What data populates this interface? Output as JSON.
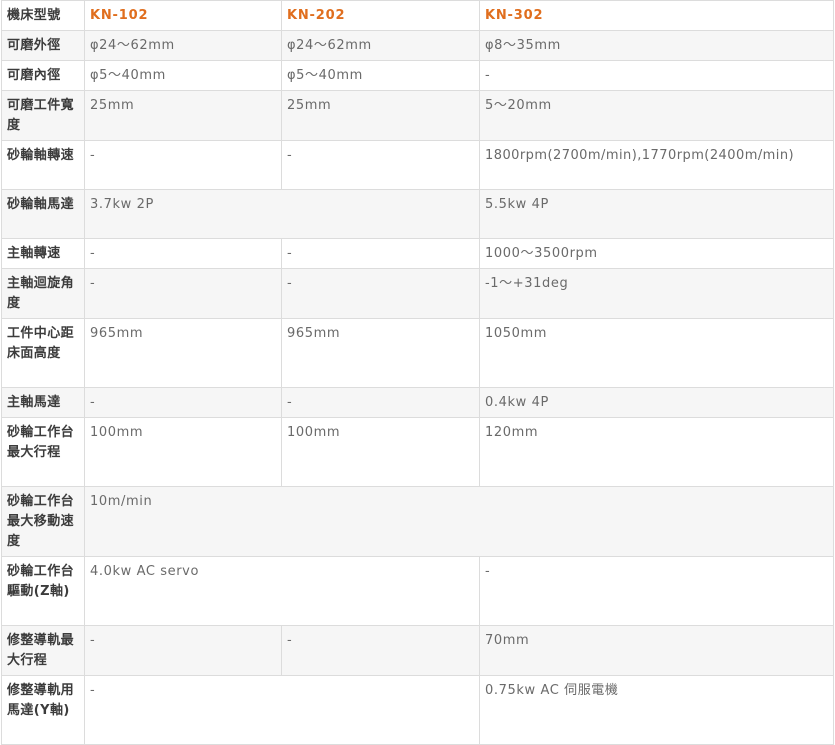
{
  "table": {
    "header": {
      "label": "機床型號",
      "models": [
        "KN-102",
        "KN-202",
        "KN-302"
      ]
    },
    "rows": [
      {
        "label": "可磨外徑",
        "kn102": "φ24～62mm",
        "kn202": "φ24～62mm",
        "kn302": "φ8～35mm"
      },
      {
        "label": "可磨內徑",
        "kn102": "φ5～40mm",
        "kn202": "φ5～40mm",
        "kn302": "-"
      },
      {
        "label": "可磨工件寬度",
        "kn102": "25mm",
        "kn202": "25mm",
        "kn302": "5～20mm"
      },
      {
        "label": "砂輪軸轉速",
        "kn102": "-",
        "kn202": "-",
        "kn302": "1800rpm(2700m/min),1770rpm(2400m/min)"
      },
      {
        "label": "砂輪軸馬達",
        "kn102_202": "3.7kw 2P",
        "kn302": "5.5kw 4P"
      },
      {
        "label": "主軸轉速",
        "kn102": "-",
        "kn202": "-",
        "kn302": "1000～3500rpm"
      },
      {
        "label": "主軸迴旋角度",
        "kn102": "-",
        "kn202": "-",
        "kn302": "-1～+31deg"
      },
      {
        "label": "工件中心距床面高度",
        "kn102": "965mm",
        "kn202": "965mm",
        "kn302": "1050mm"
      },
      {
        "label": "主軸馬達",
        "kn102": "-",
        "kn202": "-",
        "kn302": "0.4kw 4P"
      },
      {
        "label": "砂輪工作台最大行程",
        "kn102": "100mm",
        "kn202": "100mm",
        "kn302": "120mm"
      },
      {
        "label": "砂輪工作台最大移動速度",
        "all": "10m/min"
      },
      {
        "label": "砂輪工作台驅動(Z軸)",
        "kn102_202": "4.0kw AC servo",
        "kn302": "-"
      },
      {
        "label": "修整導軌最大行程",
        "kn102": "-",
        "kn202": "-",
        "kn302": "70mm"
      },
      {
        "label": "修整導軌用馬達(Y軸)",
        "kn102_202": "-",
        "kn302": "0.75kw AC 伺服電機"
      }
    ]
  }
}
